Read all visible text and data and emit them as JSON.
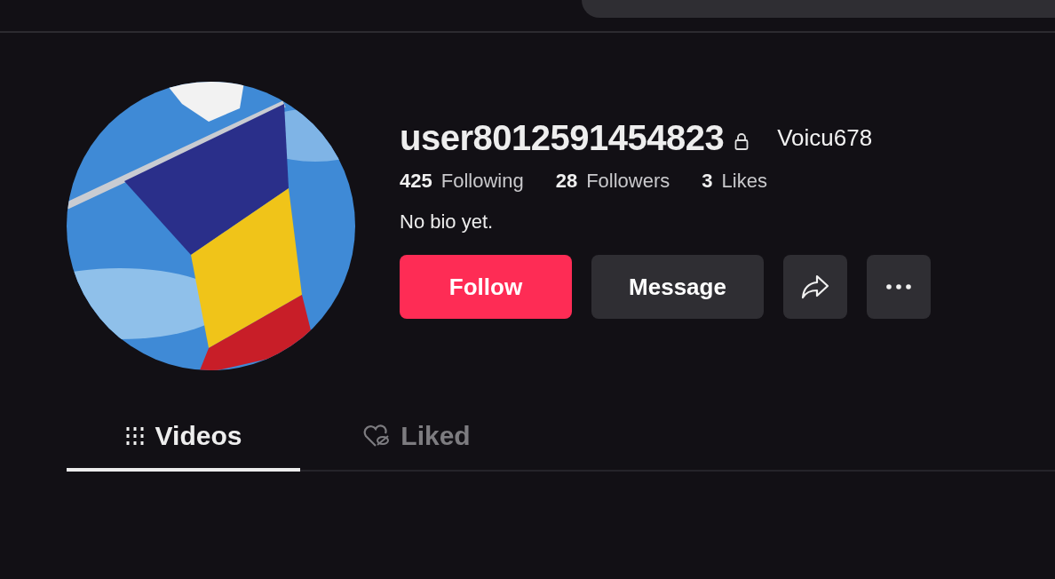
{
  "profile": {
    "username": "user8012591454823",
    "private": true,
    "nickname": "Voicu678",
    "stats": [
      {
        "count": "425",
        "unit": "Following"
      },
      {
        "count": "28",
        "unit": "Followers"
      },
      {
        "count": "3",
        "unit": "Likes"
      }
    ],
    "bio": "No bio yet.",
    "buttons": [
      {
        "kind": "primary",
        "label": "Follow"
      },
      {
        "kind": "secondary",
        "label": "Message"
      },
      {
        "kind": "share"
      },
      {
        "kind": "more"
      }
    ]
  },
  "tabs": [
    {
      "kind": "videos",
      "label": "Videos",
      "selected": true
    },
    {
      "kind": "liked",
      "label": "Liked",
      "selected": false
    }
  ]
}
